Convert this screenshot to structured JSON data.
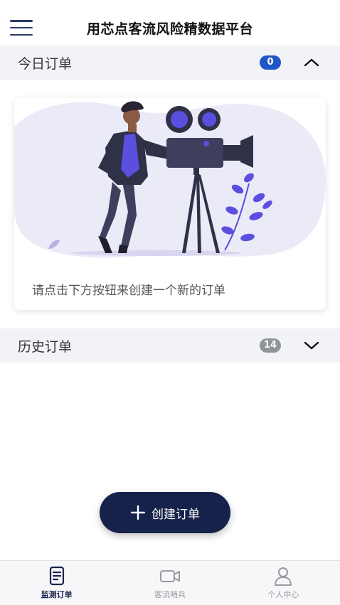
{
  "header": {
    "title": "用芯点客流风险精数据平台",
    "menu_icon": "hamburger-icon"
  },
  "today_section": {
    "title": "今日订单",
    "count": "0",
    "expanded": true,
    "badge_color": "#1f56c6"
  },
  "empty_card": {
    "message": "请点击下方按钮来创建一个新的订单"
  },
  "history_section": {
    "title": "历史订单",
    "count": "14",
    "expanded": false,
    "badge_color": "#8f949b"
  },
  "create_button": {
    "label": "创建订单",
    "icon": "plus-icon"
  },
  "tabbar": {
    "items": [
      {
        "label": "监测订单",
        "icon": "document-icon",
        "active": true
      },
      {
        "label": "客流哨兵",
        "icon": "video-camera-icon",
        "active": false
      },
      {
        "label": "个人中心",
        "icon": "user-icon",
        "active": false
      }
    ]
  },
  "colors": {
    "accent": "#5b4fe0",
    "navy": "#16224a",
    "section_bg": "#f2f3f6"
  }
}
